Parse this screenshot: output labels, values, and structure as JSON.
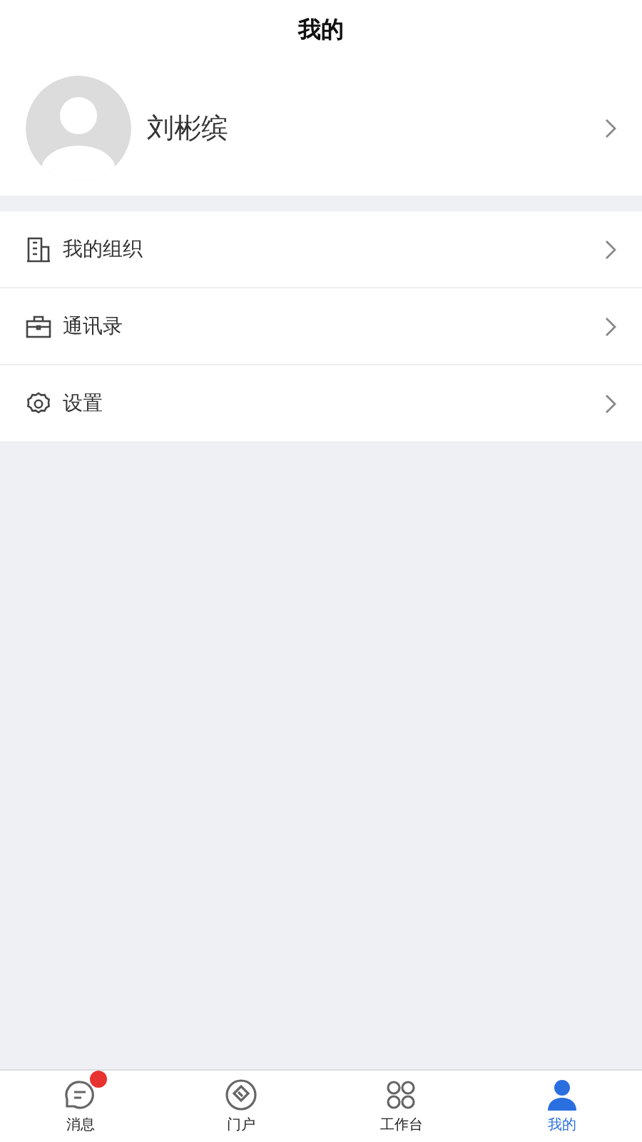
{
  "header": {
    "title": "我的"
  },
  "profile": {
    "name": "刘彬缤"
  },
  "menu": [
    {
      "kind": "building",
      "label": "我的组织"
    },
    {
      "kind": "briefcase",
      "label": "通讯录"
    },
    {
      "kind": "gear",
      "label": "设置"
    }
  ],
  "tabs": [
    {
      "kind": "message",
      "label": "消息",
      "selected": false,
      "badge": true
    },
    {
      "kind": "portal",
      "label": "门户",
      "selected": false,
      "badge": false
    },
    {
      "kind": "workbench",
      "label": "工作台",
      "selected": false,
      "badge": false
    },
    {
      "kind": "person",
      "label": "我的",
      "selected": true,
      "badge": false
    }
  ]
}
